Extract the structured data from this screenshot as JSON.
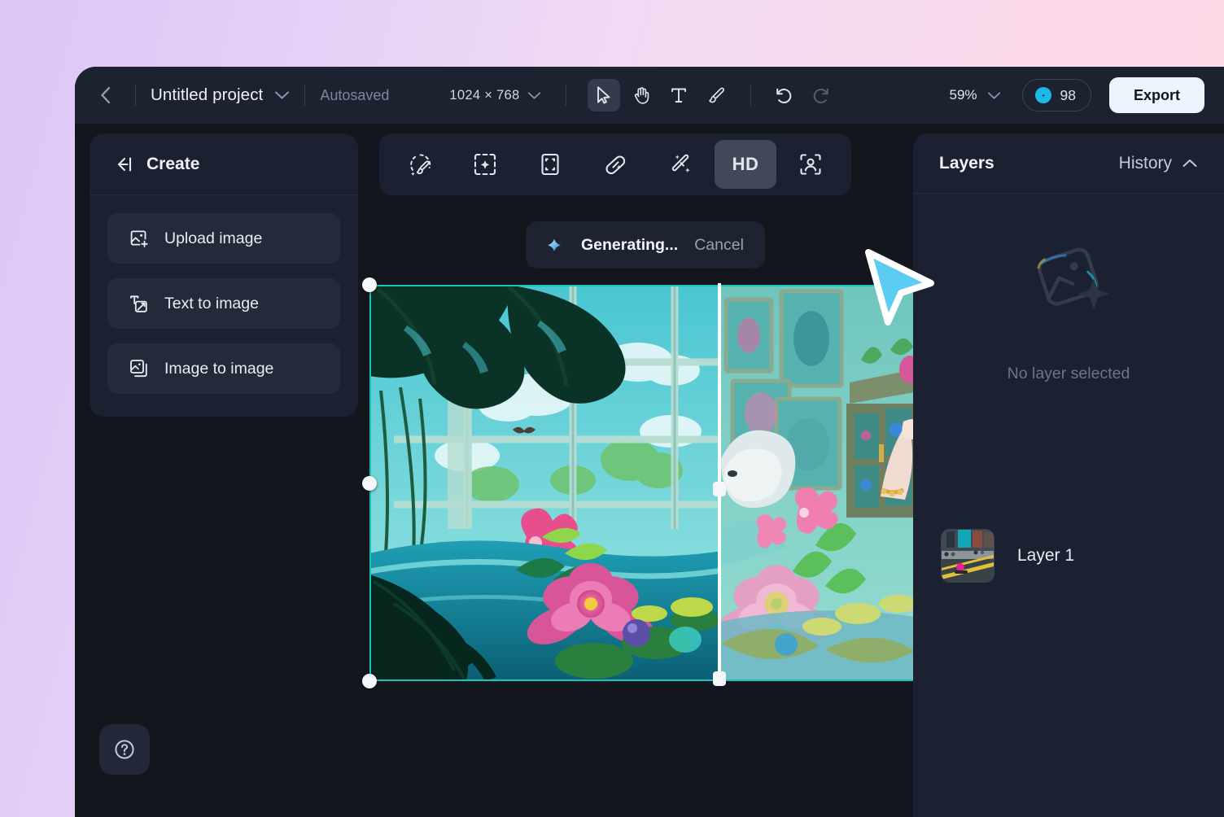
{
  "header": {
    "back_icon": "chevron-left-icon",
    "project_title": "Untitled project",
    "project_dropdown_icon": "chevron-down-icon",
    "autosaved_label": "Autosaved",
    "canvas_dimensions": "1024 × 768",
    "dimensions_dropdown_icon": "chevron-down-icon",
    "tools": [
      {
        "name": "select-tool",
        "icon": "cursor-arrow-icon",
        "active": true
      },
      {
        "name": "pan-tool",
        "icon": "hand-icon",
        "active": false
      },
      {
        "name": "text-tool",
        "icon": "text-t-icon",
        "active": false
      },
      {
        "name": "brush-tool",
        "icon": "paintbrush-icon",
        "active": false
      }
    ],
    "history_tools": [
      {
        "name": "undo-button",
        "icon": "undo-arrow-icon",
        "enabled": true
      },
      {
        "name": "redo-button",
        "icon": "redo-arrow-icon",
        "enabled": false
      }
    ],
    "zoom_level": "59%",
    "zoom_dropdown_icon": "chevron-down-icon",
    "credits_icon": "credit-coin-icon",
    "credits_count": "98",
    "export_label": "Export"
  },
  "left_panel": {
    "collapse_icon": "collapse-panel-left-icon",
    "title": "Create",
    "items": [
      {
        "label": "Upload image",
        "icon": "image-plus-icon"
      },
      {
        "label": "Text to image",
        "icon": "text-to-image-icon"
      },
      {
        "label": "Image to image",
        "icon": "image-stack-icon"
      }
    ],
    "help_icon": "question-mark-circle-icon"
  },
  "float_toolbar": {
    "items": [
      {
        "name": "magic-brush-tool",
        "icon": "magic-brush-icon",
        "label": "",
        "active": false
      },
      {
        "name": "generative-fill-tool",
        "icon": "generative-fill-icon",
        "label": "",
        "active": false
      },
      {
        "name": "expand-canvas-tool",
        "icon": "expand-frame-icon",
        "label": "",
        "active": false
      },
      {
        "name": "healing-eraser-tool",
        "icon": "eraser-patch-icon",
        "label": "",
        "active": false
      },
      {
        "name": "magic-wand-tool",
        "icon": "magic-wand-icon",
        "label": "",
        "active": false
      },
      {
        "name": "hd-upscale-tool",
        "icon": "hd-text-icon",
        "label": "HD",
        "active": true
      },
      {
        "name": "portrait-enhance-tool",
        "icon": "person-frame-icon",
        "label": "",
        "active": false
      }
    ]
  },
  "generating": {
    "spinner_icon": "generating-spark-icon",
    "label": "Generating...",
    "cancel_label": "Cancel"
  },
  "canvas": {
    "selection_color": "#18c4b8",
    "comparison_divider": true,
    "handles": [
      "top-left",
      "middle-left",
      "bottom-left"
    ]
  },
  "right_panel": {
    "layers_tab": "Layers",
    "history_tab": "History",
    "history_chevron_icon": "chevron-up-icon",
    "empty_icon": "image-sparkle-placeholder-icon",
    "empty_label": "No layer selected",
    "layers": [
      {
        "name": "Layer 1",
        "thumbnail": "street-scene-thumbnail"
      }
    ]
  },
  "cursor": {
    "icon": "pointer-arrow-cursor",
    "color": "#5ccdf2"
  },
  "theme": {
    "app_bg": "#14161d",
    "panel_bg": "#1b2130",
    "header_bg": "#1c2230",
    "accent": "#18c4b8",
    "page_gradient_from": "#dcc6f5",
    "page_gradient_to": "#ffd9e6"
  }
}
